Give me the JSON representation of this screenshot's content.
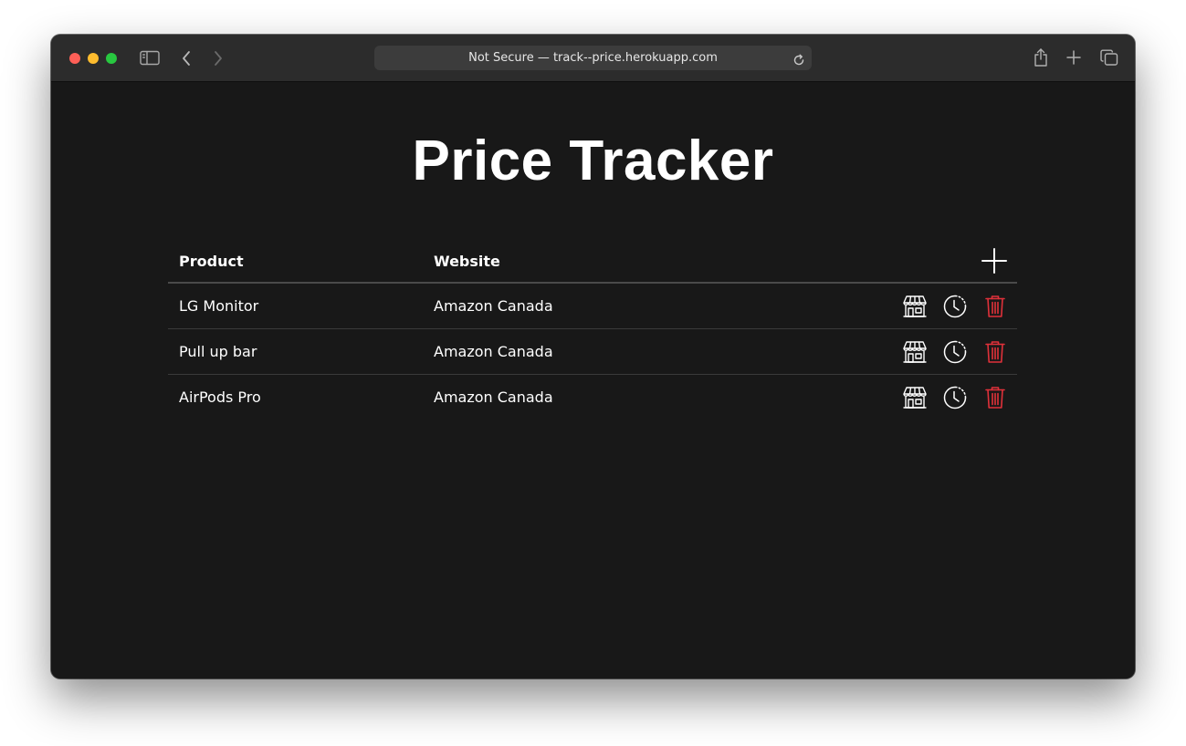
{
  "browser": {
    "address_text": "Not Secure — track--price.herokuapp.com",
    "icons": [
      "sidebar-icon",
      "back-icon",
      "forward-icon",
      "reload-icon",
      "share-icon",
      "new-tab-icon",
      "tab-overview-icon"
    ]
  },
  "page": {
    "title": "Price Tracker"
  },
  "table": {
    "columns": {
      "product": "Product",
      "website": "Website"
    },
    "rows": [
      {
        "product": "LG Monitor",
        "website": "Amazon Canada"
      },
      {
        "product": "Pull up bar",
        "website": "Amazon Canada"
      },
      {
        "product": "AirPods Pro",
        "website": "Amazon Canada"
      }
    ],
    "row_action_icons": [
      "store-icon",
      "history-clock-icon",
      "trash-icon"
    ]
  },
  "colors": {
    "background": "#181818",
    "toolbar": "#2c2c2c",
    "address_bar": "#3c3c3c",
    "text": "#ffffff",
    "delete_accent": "#e0313a"
  }
}
